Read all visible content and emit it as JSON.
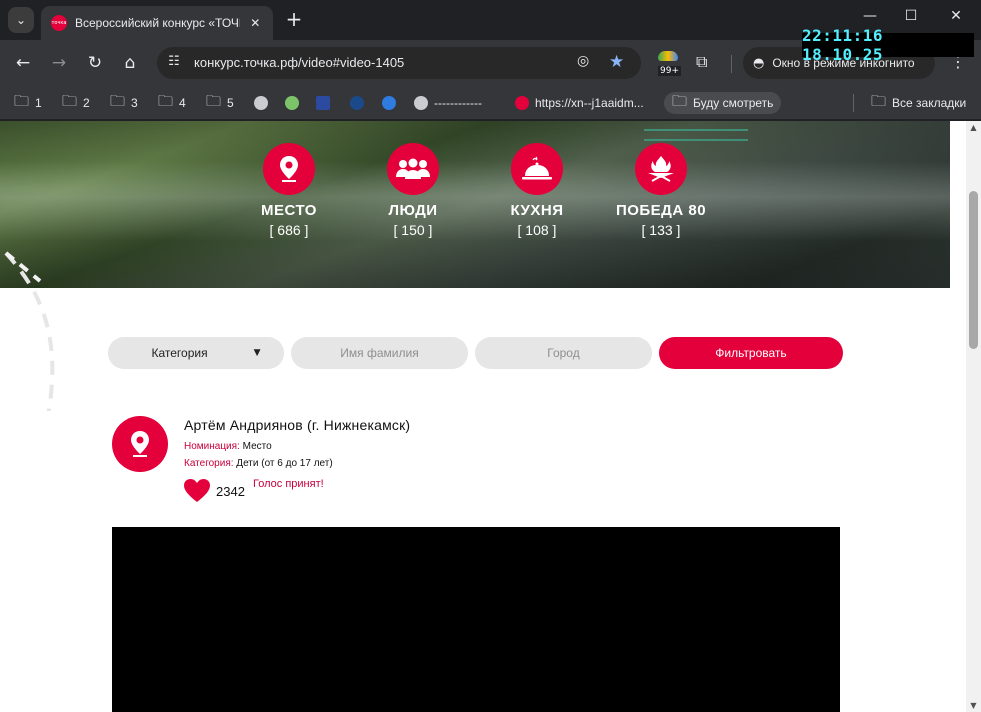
{
  "browser": {
    "tab_title": "Всероссийский конкурс «ТОЧКА",
    "tab_favicon_text": "точка",
    "new_tab_label": "+",
    "url": "конкурс.точка.рф/video#video-1405",
    "extension_badge": "99+",
    "incognito_label": "Окно в режиме инкогнито",
    "clock": "22:11:16 18.10.25",
    "bookmarks": [
      {
        "label": "1",
        "icon": "folder-icon"
      },
      {
        "label": "2",
        "icon": "folder-icon"
      },
      {
        "label": "3",
        "icon": "folder-icon"
      },
      {
        "label": "4",
        "icon": "folder-icon"
      },
      {
        "label": "5",
        "icon": "folder-icon"
      },
      {
        "label": "------------",
        "icon": "globe-icon"
      },
      {
        "label": "https://xn--j1aaidm...",
        "icon": "site-favicon"
      },
      {
        "label": "Буду смотреть",
        "icon": "folder-icon"
      }
    ],
    "all_bookmarks_label": "Все закладки"
  },
  "page": {
    "categories": [
      {
        "name": "МЕСТО",
        "count": "[ 686 ]",
        "icon": "map-pin-icon"
      },
      {
        "name": "ЛЮДИ",
        "count": "[ 150 ]",
        "icon": "people-icon"
      },
      {
        "name": "КУХНЯ",
        "count": "[ 108 ]",
        "icon": "cloche-icon"
      },
      {
        "name": "ПОБЕДА 80",
        "count": "[ 133 ]",
        "icon": "eternal-flame-icon"
      }
    ],
    "filters": {
      "category_label": "Категория",
      "name_placeholder": "Имя фамилия",
      "city_placeholder": "Город",
      "submit_label": "Фильтровать"
    },
    "entry": {
      "title": "Артём Андриянов (г. Нижнекамск)",
      "nomination_key": "Номинация:",
      "nomination_value": " Место",
      "category_key": "Категория:",
      "category_value": " Дети (от 6 до 17 лет)",
      "votes": "2342",
      "vote_status": "Голос принят!"
    }
  },
  "colors": {
    "accent": "#e4003a",
    "browser_bg": "#202124",
    "toolbar_bg": "#35363a"
  }
}
